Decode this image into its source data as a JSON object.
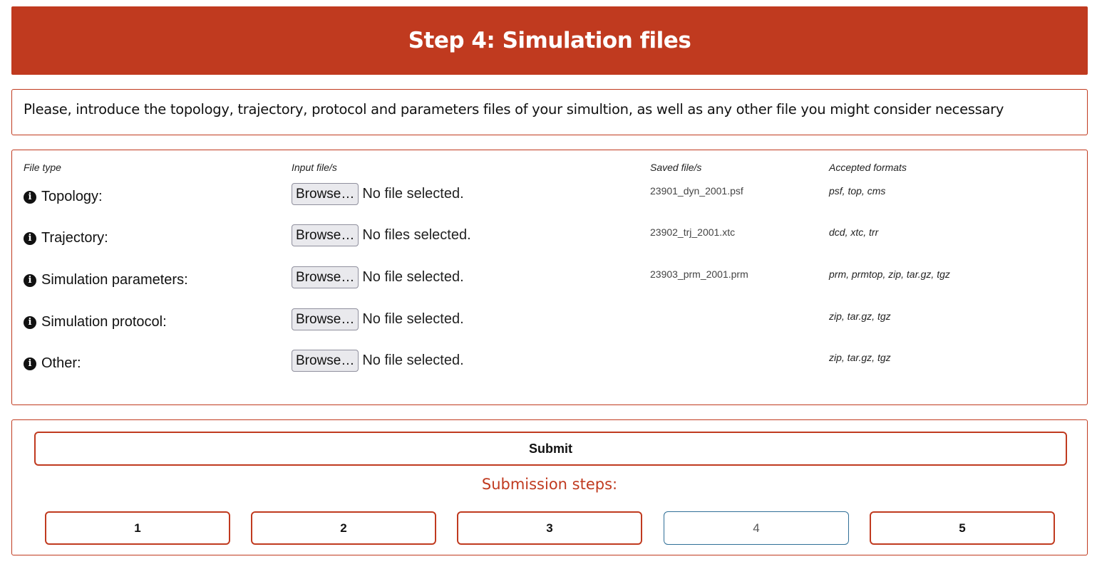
{
  "header": {
    "title": "Step 4: Simulation files"
  },
  "intro": {
    "text": "Please, introduce the topology, trajectory, protocol and parameters files of your simultion, as well as any other file you might consider necessary"
  },
  "files_table": {
    "columns": {
      "file_type": "File type",
      "input": "Input file/s",
      "saved": "Saved file/s",
      "formats": "Accepted formats"
    },
    "rows": [
      {
        "type": "Topology:",
        "browse": "Browse…",
        "status": "No file selected.",
        "saved": "23901_dyn_2001.psf",
        "formats": "psf, top, cms"
      },
      {
        "type": "Trajectory:",
        "browse": "Browse…",
        "status": "No files selected.",
        "saved": "23902_trj_2001.xtc",
        "formats": "dcd, xtc, trr"
      },
      {
        "type": "Simulation parameters:",
        "browse": "Browse…",
        "status": "No file selected.",
        "saved": "23903_prm_2001.prm",
        "formats": "prm, prmtop, zip, tar.gz, tgz"
      },
      {
        "type": "Simulation protocol:",
        "browse": "Browse…",
        "status": "No file selected.",
        "saved": "",
        "formats": "zip, tar.gz, tgz"
      },
      {
        "type": "Other:",
        "browse": "Browse…",
        "status": "No file selected.",
        "saved": "",
        "formats": "zip, tar.gz, tgz"
      }
    ]
  },
  "actions": {
    "submit_label": "Submit",
    "steps_title": "Submission steps:",
    "steps": [
      "1",
      "2",
      "3",
      "4",
      "5"
    ],
    "current_step": "4"
  },
  "colors": {
    "accent": "#c03a1f",
    "current_step_border": "#2f6f97"
  },
  "icons": {
    "info": "info-circle-icon"
  }
}
